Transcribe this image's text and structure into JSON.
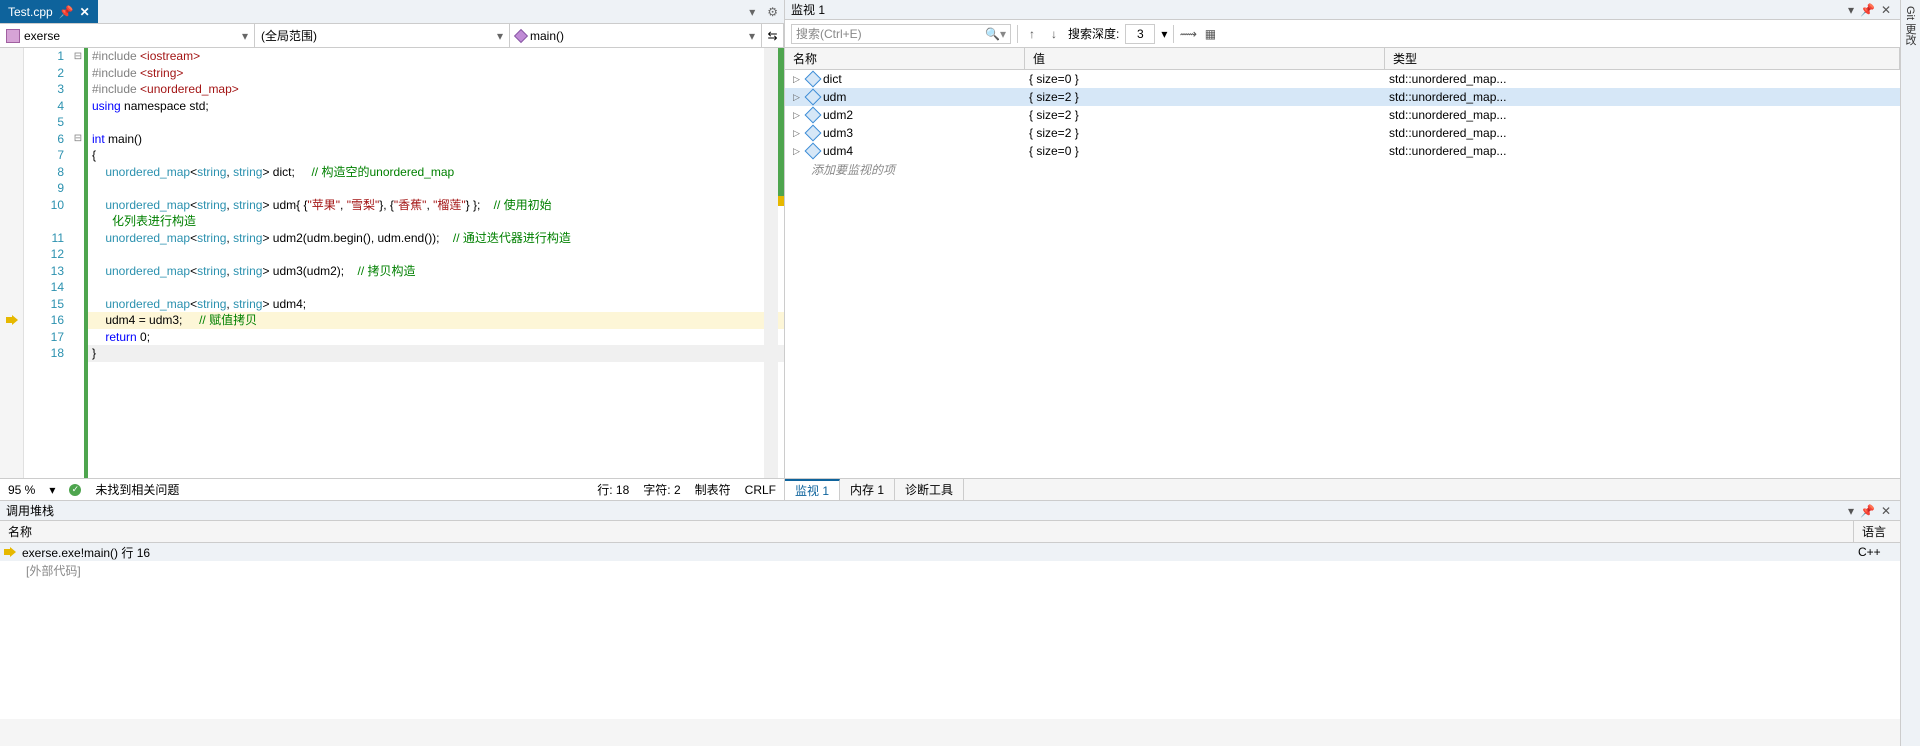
{
  "tab": {
    "name": "Test.cpp",
    "pin": "📌",
    "close": "✕"
  },
  "combos": {
    "c1": "exerse",
    "c2": "(全局范围)",
    "c3": "main()"
  },
  "lines": [
    "1",
    "2",
    "3",
    "4",
    "5",
    "6",
    "7",
    "8",
    "9",
    "10",
    "",
    "11",
    "12",
    "13",
    "14",
    "15",
    "16",
    "17",
    "18"
  ],
  "code": {
    "l1a": "#include ",
    "l1b": "<iostream>",
    "l2a": "#include ",
    "l2b": "<string>",
    "l3a": "#include ",
    "l3b": "<unordered_map>",
    "l4a": "using",
    "l4b": " namespace ",
    "l4c": "std",
    "l6a": "int",
    "l6b": " main()",
    "l7": "{",
    "l8a": "    unordered_map",
    "l8b": "<",
    "l8c": "string",
    "l8d": ", ",
    "l8e": "string",
    "l8f": "> dict;     ",
    "l8g": "// 构造空的unordered_map",
    "l10a": "    unordered_map",
    "l10b": "<",
    "l10c": "string",
    "l10d": ", ",
    "l10e": "string",
    "l10f": "> udm{ {",
    "l10g": "\"苹果\"",
    "l10h": ", ",
    "l10i": "\"雪梨\"",
    "l10j": "}, {",
    "l10k": "\"香蕉\"",
    "l10l": ", ",
    "l10m": "\"榴莲\"",
    "l10n": "} };    ",
    "l10o": "// 使用初始",
    "l10p": "      化列表进行构造",
    "l11a": "    unordered_map",
    "l11b": "<",
    "l11c": "string",
    "l11d": ", ",
    "l11e": "string",
    "l11f": "> udm2(udm.begin(), udm.end());    ",
    "l11g": "// 通过迭代器进行构造",
    "l13a": "    unordered_map",
    "l13b": "<",
    "l13c": "string",
    "l13d": ", ",
    "l13e": "string",
    "l13f": "> udm3(udm2);    ",
    "l13g": "// 拷贝构造",
    "l15a": "    unordered_map",
    "l15b": "<",
    "l15c": "string",
    "l15d": ", ",
    "l15e": "string",
    "l15f": "> udm4;",
    "l16a": "    udm4 = udm3;     ",
    "l16b": "// 赋值拷贝",
    "l17a": "    return",
    "l17b": " 0;",
    "l18": "}"
  },
  "status": {
    "zoom": "95 %",
    "issues": "未找到相关问题",
    "line": "行: 18",
    "char": "字符: 2",
    "tabs": "制表符",
    "crlf": "CRLF"
  },
  "watch": {
    "title": "监视 1",
    "search_ph": "搜索(Ctrl+E)",
    "depth_label": "搜索深度:",
    "depth_val": "3",
    "hdr_name": "名称",
    "hdr_val": "值",
    "hdr_type": "类型",
    "rows": [
      {
        "name": "dict",
        "val": "{ size=0 }",
        "type": "std::unordered_map..."
      },
      {
        "name": "udm",
        "val": "{ size=2 }",
        "type": "std::unordered_map..."
      },
      {
        "name": "udm2",
        "val": "{ size=2 }",
        "type": "std::unordered_map..."
      },
      {
        "name": "udm3",
        "val": "{ size=2 }",
        "type": "std::unordered_map..."
      },
      {
        "name": "udm4",
        "val": "{ size=0 }",
        "type": "std::unordered_map..."
      }
    ],
    "add": "添加要监视的项",
    "tabs": [
      "监视 1",
      "内存 1",
      "诊断工具"
    ]
  },
  "callstack": {
    "title": "调用堆栈",
    "hdr_name": "名称",
    "hdr_lang": "语言",
    "row1": "exerse.exe!main() 行 16",
    "row1_lang": "C++",
    "row2": "[外部代码]"
  },
  "rail": "Git 更改"
}
